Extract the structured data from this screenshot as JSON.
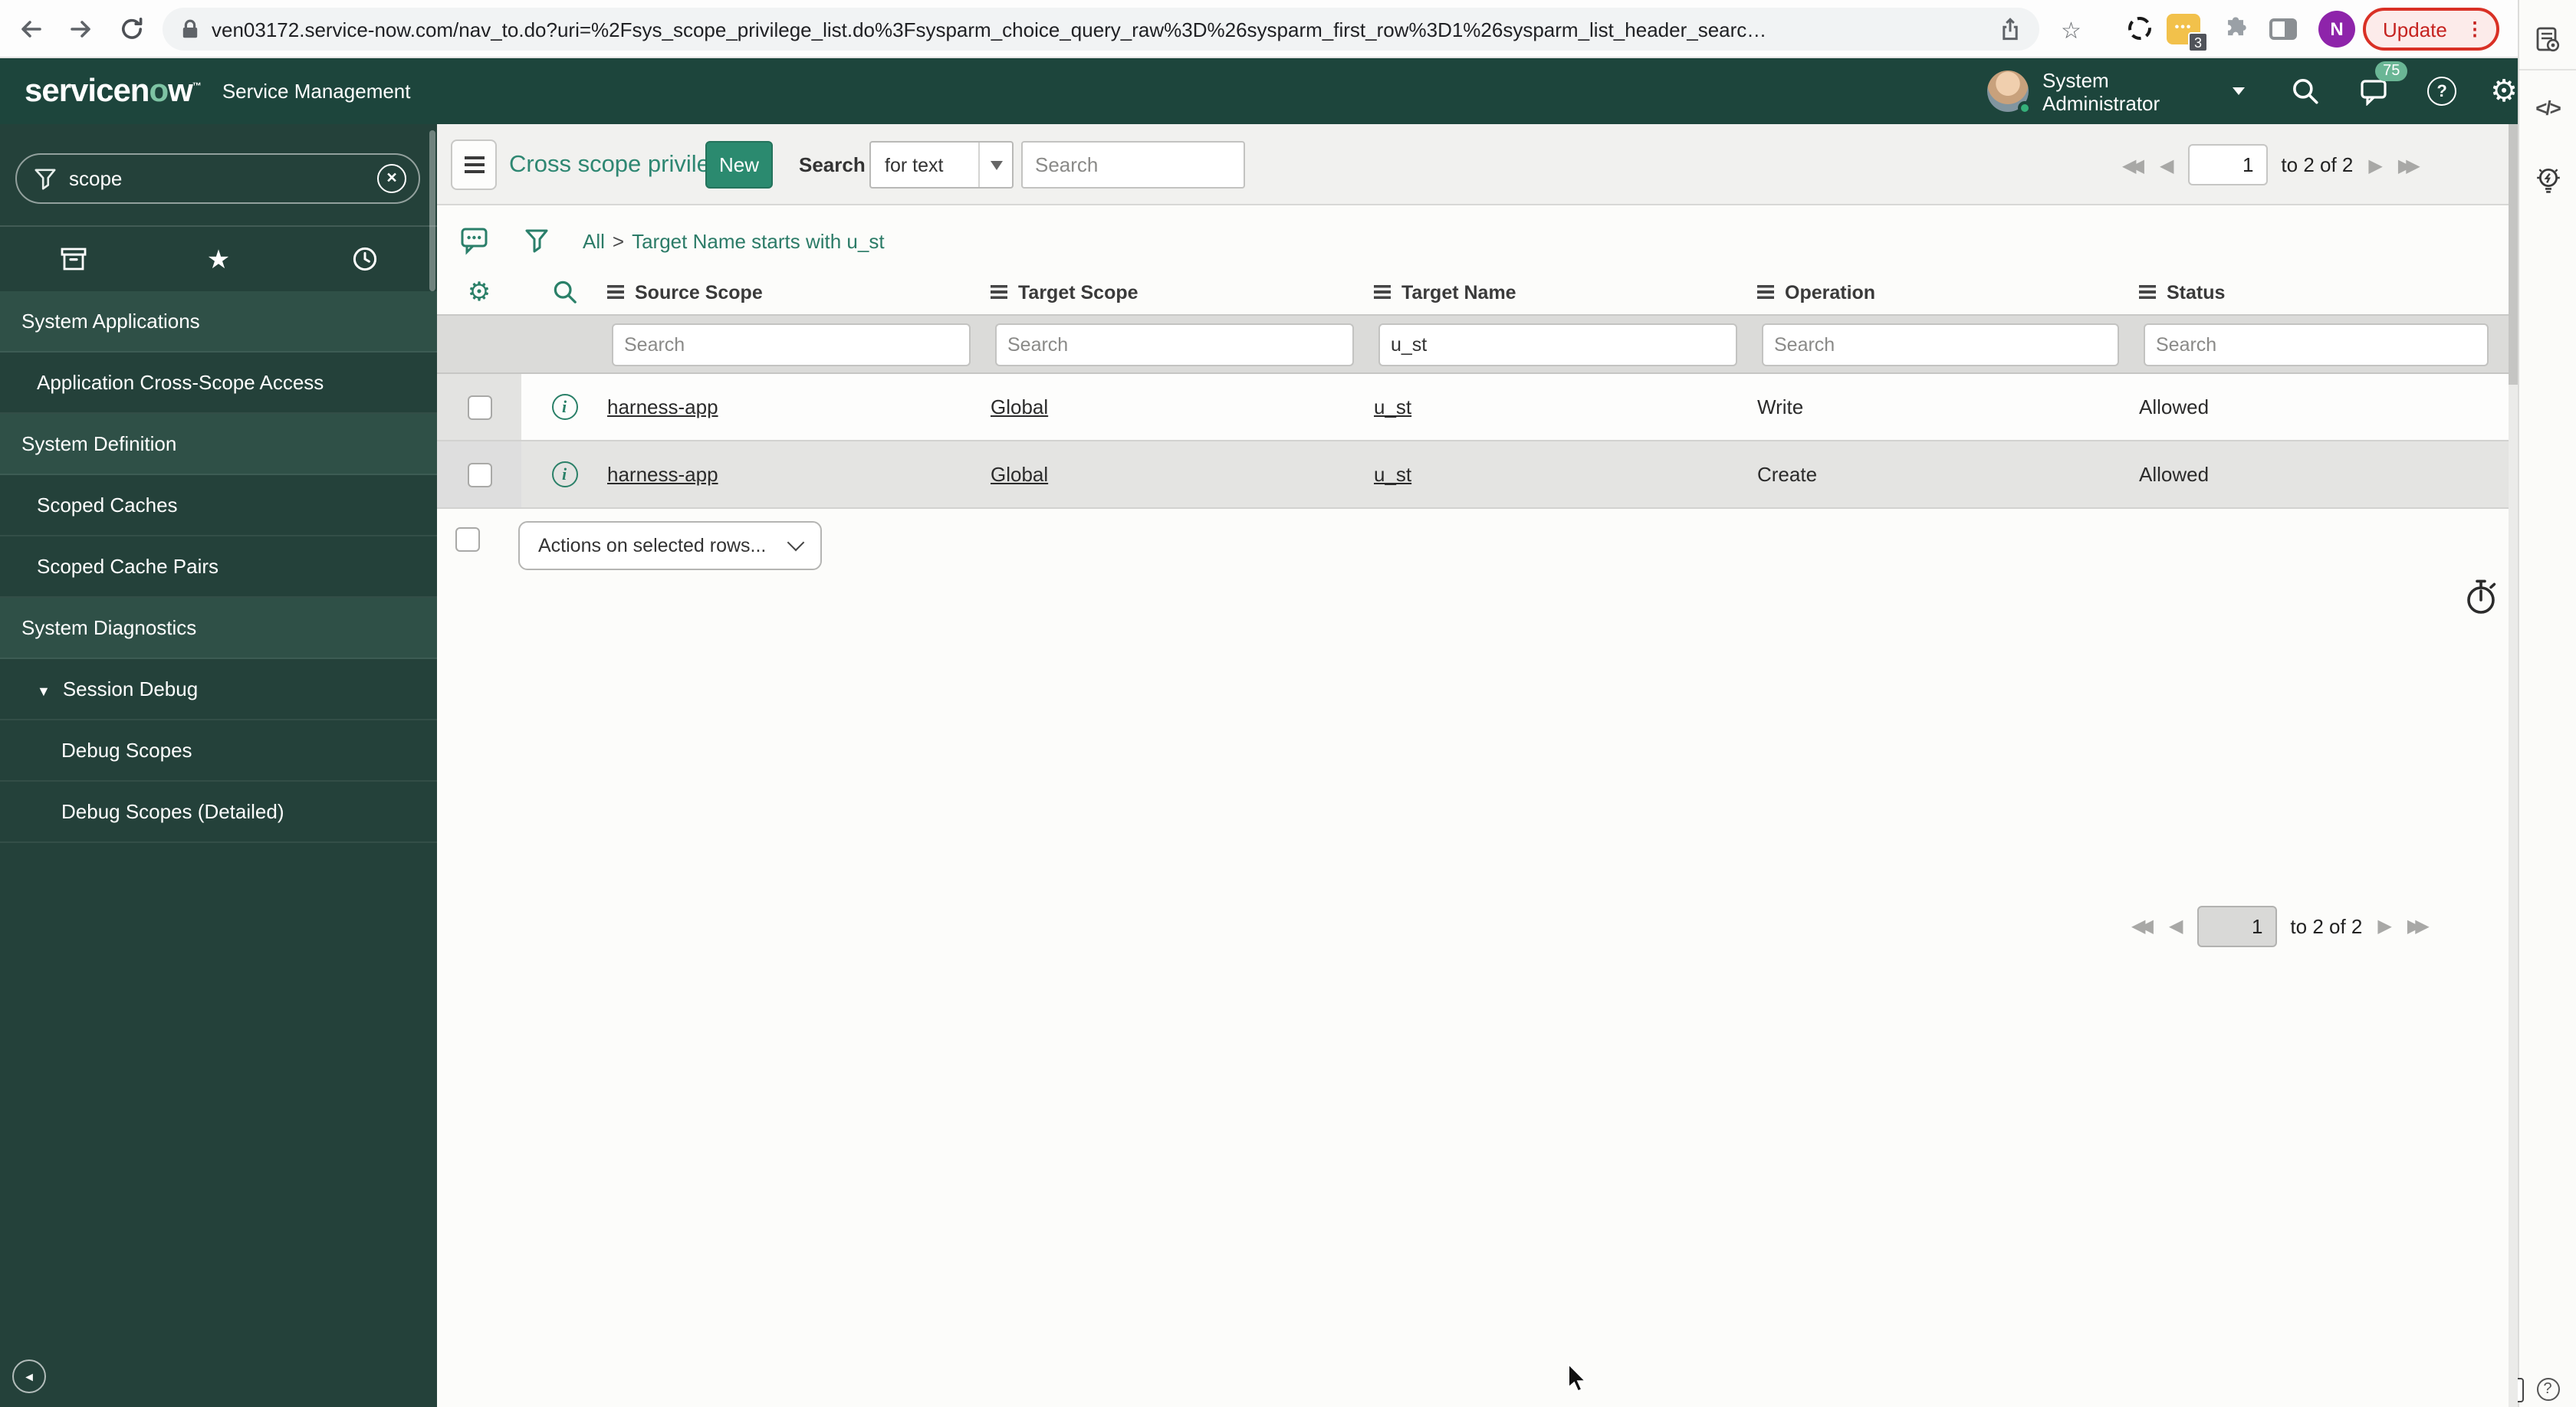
{
  "browser": {
    "url": "ven03172.service-now.com/nav_to.do?uri=%2Fsys_scope_privilege_list.do%3Fsysparm_choice_query_raw%3D%26sysparm_first_row%3D1%26sysparm_list_header_searc…",
    "extension_badge": "3",
    "profile_initial": "N",
    "update_label": "Update"
  },
  "rail": {
    "code_glyph": "</>"
  },
  "header": {
    "logo": {
      "pre": "servicen",
      "accent": "o",
      "post": "w",
      "tm": "™"
    },
    "product": "Service Management",
    "user_name": "System Administrator",
    "notification_count": "75"
  },
  "sidebar": {
    "search_value": "scope",
    "items": [
      {
        "label": "System Applications",
        "type": "section"
      },
      {
        "label": "Application Cross-Scope Access",
        "type": "item"
      },
      {
        "label": "System Definition",
        "type": "section"
      },
      {
        "label": "Scoped Caches",
        "type": "item"
      },
      {
        "label": "Scoped Cache Pairs",
        "type": "item"
      },
      {
        "label": "System Diagnostics",
        "type": "section"
      },
      {
        "label": "Session Debug",
        "type": "item-expanded"
      },
      {
        "label": "Debug Scopes",
        "type": "subitem"
      },
      {
        "label": "Debug Scopes (Detailed)",
        "type": "subitem"
      }
    ]
  },
  "toolbar": {
    "title": "Cross scope privileges",
    "new_label": "New",
    "search_label": "Search",
    "search_mode": "for text",
    "search_placeholder": "Search"
  },
  "breadcrumb": {
    "root": "All",
    "separator": ">",
    "active_filter": "Target Name starts with u_st"
  },
  "pagination": {
    "page": "1",
    "range_label": "to 2 of 2"
  },
  "list": {
    "columns": [
      "Source Scope",
      "Target Scope",
      "Target Name",
      "Operation",
      "Status"
    ],
    "filter_placeholder": "Search",
    "filters": {
      "target_name": "u_st"
    },
    "rows": [
      {
        "source_scope": "harness-app",
        "target_scope": "Global",
        "target_name": "u_st",
        "operation": "Write",
        "status": "Allowed"
      },
      {
        "source_scope": "harness-app",
        "target_scope": "Global",
        "target_name": "u_st",
        "operation": "Create",
        "status": "Allowed"
      }
    ],
    "actions_label": "Actions on selected rows..."
  },
  "colors": {
    "accent_teal": "#2e8772",
    "header_green": "#1d453c",
    "update_red": "#c5221f",
    "new_button": "#2b8a6f"
  }
}
